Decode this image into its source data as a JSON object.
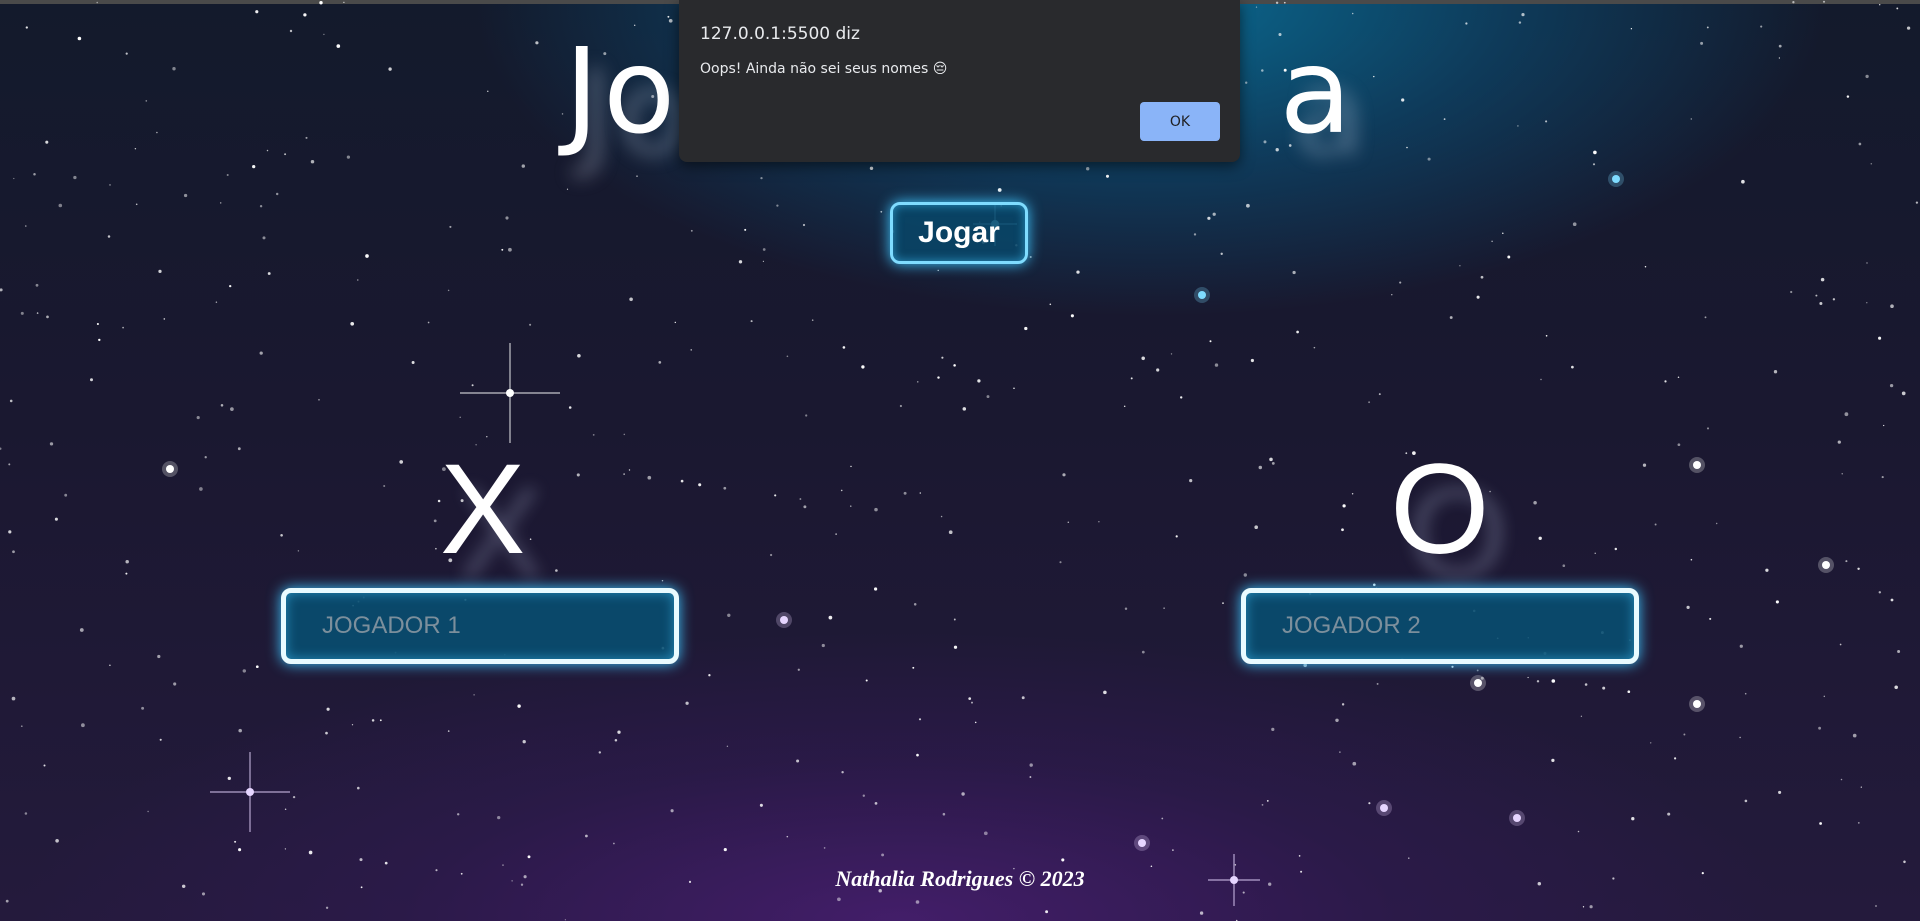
{
  "alert": {
    "origin": "127.0.0.1:5500 diz",
    "message": "Oops! Ainda não sei seus nomes 😔",
    "ok_label": "OK"
  },
  "page": {
    "title_left": "Jo",
    "title_right": "a",
    "play_label": "Jogar",
    "symbol_player1": "X",
    "symbol_player2": "O",
    "player1_placeholder": "JOGADOR 1",
    "player2_placeholder": "JOGADOR 2",
    "footer": "Nathalia Rodrigues © 2023"
  },
  "colors": {
    "accent_glow": "#3fc7ff",
    "field_border": "#e9fbff",
    "dialog_bg": "#292a2d",
    "dialog_button": "#8ab4f8"
  }
}
